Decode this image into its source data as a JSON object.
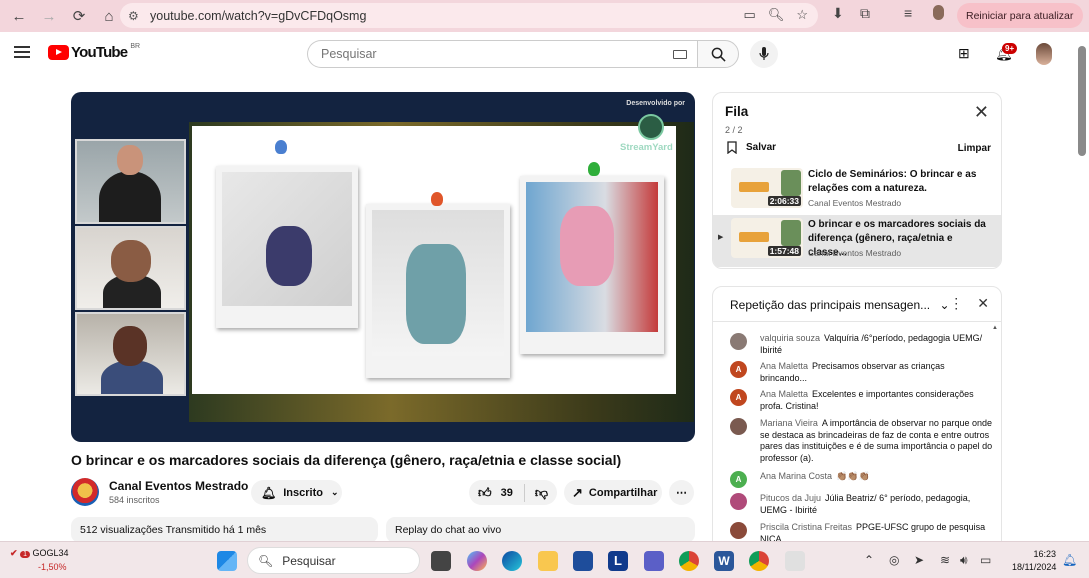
{
  "browser": {
    "url": "youtube.com/watch?v=gDvCFDqOsmg",
    "reload_label": "Reiniciar para atualizar"
  },
  "youtube": {
    "logo_text": "YouTube",
    "country_code": "BR",
    "search_placeholder": "Pesquisar",
    "notification_count": "9+"
  },
  "video": {
    "title": "O brincar e os marcadores sociais da diferença (gênero, raça/etnia e classe social)",
    "overlay_credit": "Desenvolvido por",
    "overlay_brand": "StreamYard",
    "channel_name": "Canal Eventos Mestrado",
    "subscribers": "584 inscritos",
    "subscribe_label": "Inscrito",
    "likes": "39",
    "share_label": "Compartilhar",
    "views_line": "512 visualizações  Transmitido há 1 mês",
    "chat_replay_label": "Replay do chat ao vivo"
  },
  "queue": {
    "title": "Fila",
    "count": "2 / 2",
    "save_label": "Salvar",
    "clear_label": "Limpar",
    "items": [
      {
        "title": "Ciclo de Seminários: O brincar e as relações com a natureza.",
        "channel": "Canal Eventos Mestrado",
        "duration": "2:06:33",
        "active": false
      },
      {
        "title": "O brincar e os marcadores sociais da diferença (gênero, raça/etnia e classe...",
        "channel": "Canal Eventos Mestrado",
        "duration": "1:57:48",
        "active": true
      }
    ]
  },
  "chat": {
    "header": "Repetição das principais mensagen...",
    "messages": [
      {
        "author": "valquiria souza",
        "text": "Valquíria /6°período, pedagogia UEMG/ Ibirité",
        "avatar_color": "#8a7a74",
        "initial": ""
      },
      {
        "author": "Ana Maletta",
        "text": "Precisamos observar as crianças brincando...",
        "avatar_color": "#c0471f",
        "initial": "A"
      },
      {
        "author": "Ana Maletta",
        "text": "Excelentes e importantes considerações profa. Cristina!",
        "avatar_color": "#c0471f",
        "initial": "A"
      },
      {
        "author": "Mariana Vieira",
        "text": "A importância de observar no parque onde se destaca as brincadeiras de faz de conta e entre outros pares das instituições e é de suma importância o papel do professor (a).",
        "avatar_color": "#7a5a50",
        "initial": ""
      },
      {
        "author": "Ana Marina Costa",
        "text": "👏🏽👏🏽👏🏽",
        "avatar_color": "#4caf50",
        "initial": "A"
      },
      {
        "author": "Pitucos da Juju",
        "text": "Júlia Beatriz/ 6° período, pedagogia, UEMG - Ibirité",
        "avatar_color": "#b04a7a",
        "initial": ""
      },
      {
        "author": "Priscila Cristina Freitas",
        "text": "PPGE-UFSC grupo de pesquisa NICA",
        "avatar_color": "#8a4a3a",
        "initial": ""
      }
    ]
  },
  "taskbar": {
    "stock_symbol": "GOGL34",
    "stock_change": "-1,50%",
    "stock_badge": "1",
    "search_placeholder": "Pesquisar",
    "time": "16:23",
    "date": "18/11/2024"
  }
}
